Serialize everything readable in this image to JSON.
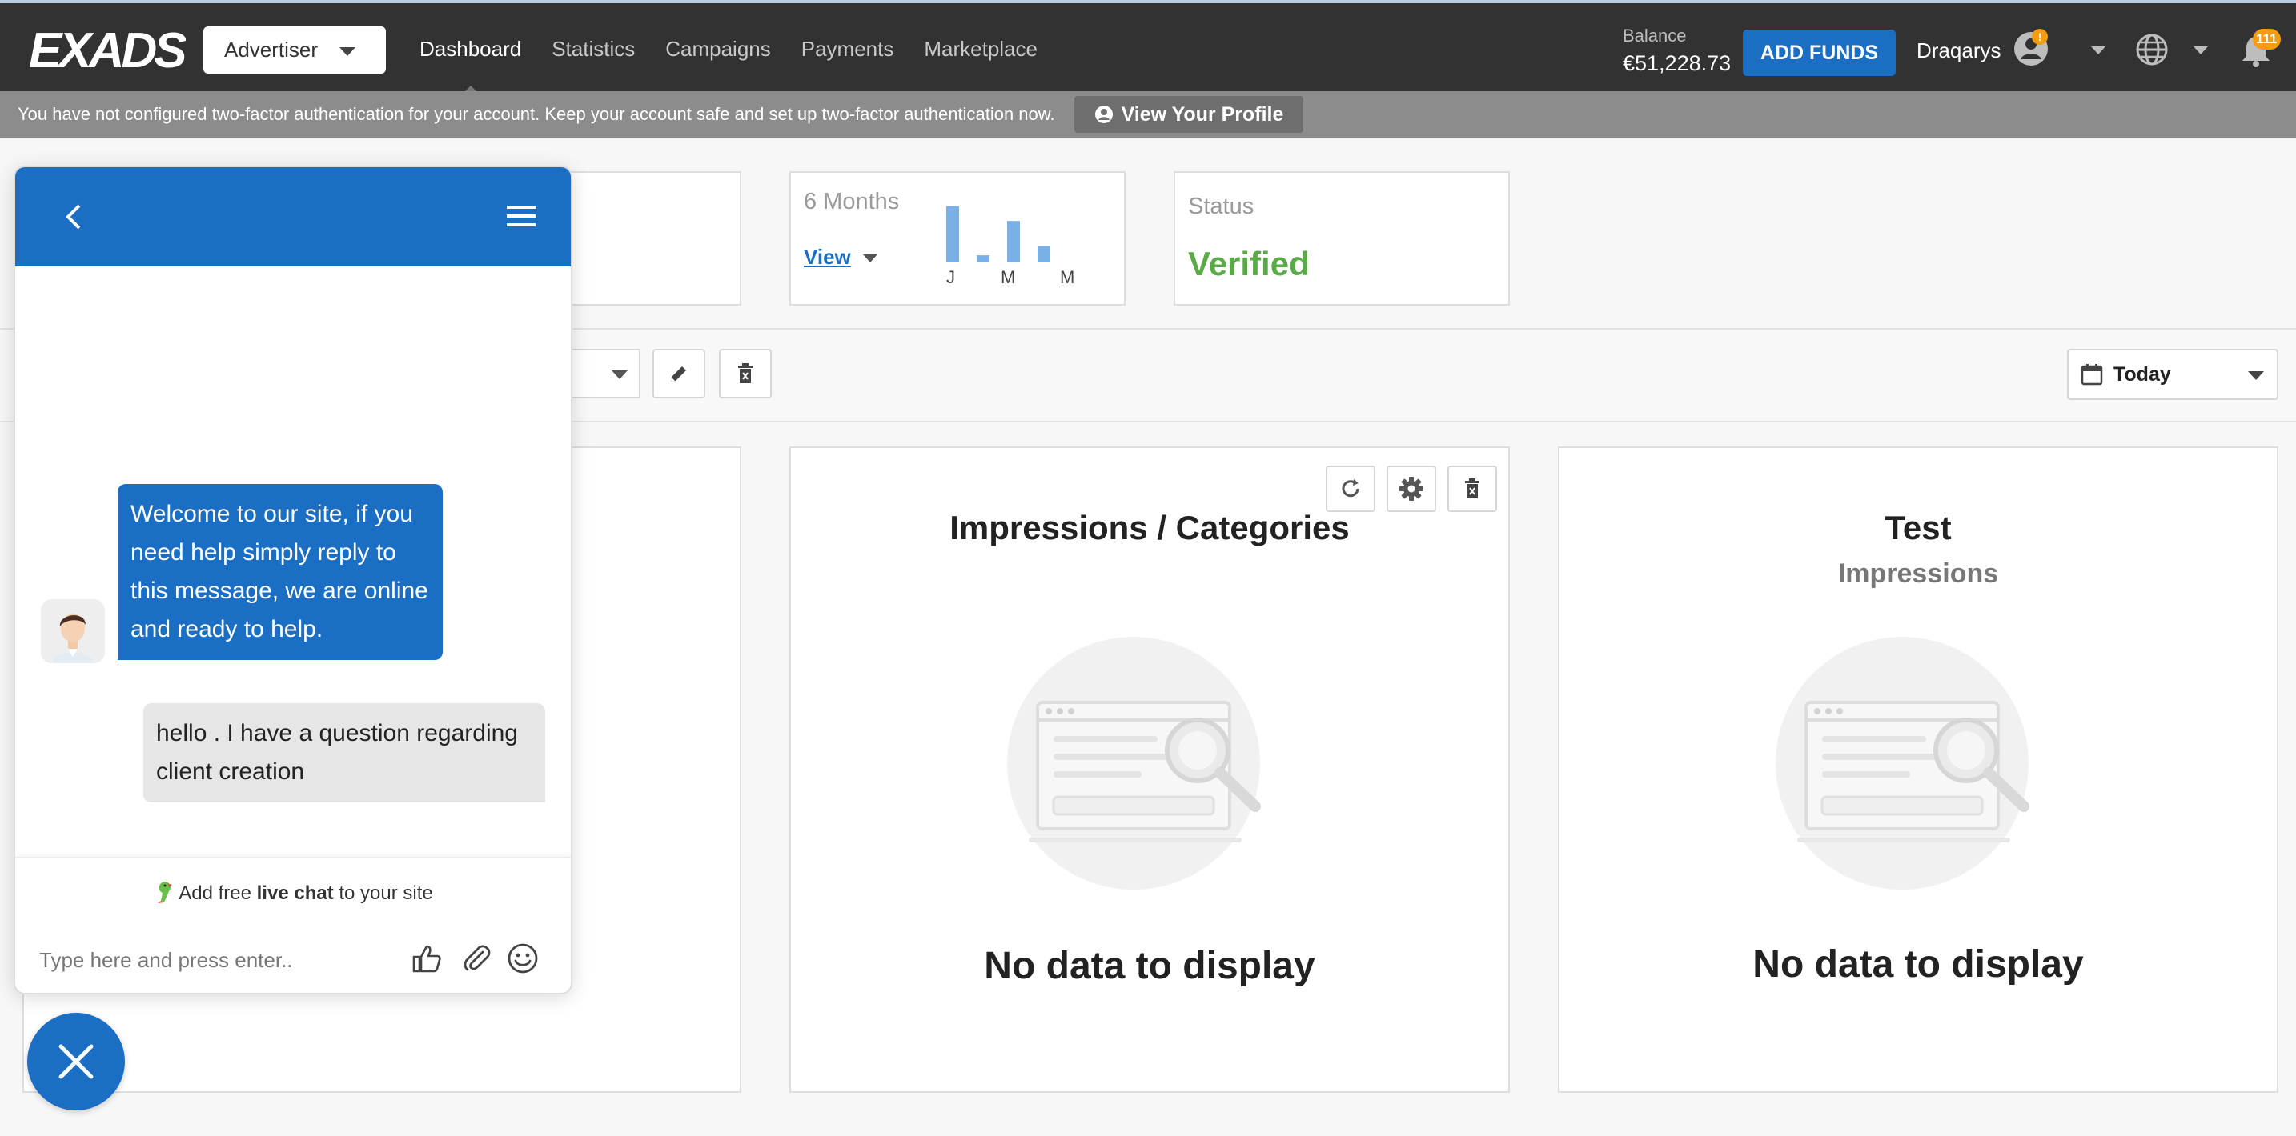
{
  "app": {
    "logo_text": "EXADS"
  },
  "topnav": {
    "role": "Advertiser",
    "links": [
      "Dashboard",
      "Statistics",
      "Campaigns",
      "Payments",
      "Marketplace"
    ],
    "active_link": "Dashboard",
    "balance_label": "Balance",
    "balance_value": "€51,228.73",
    "add_funds_label": "ADD FUNDS",
    "username": "Draqarys",
    "user_badge": "!",
    "notifications_count": "111"
  },
  "banner": {
    "message": "You have not configured two-factor authentication for your account. Keep your account safe and set up two-factor authentication now.",
    "action_label": "View Your Profile"
  },
  "summary": {
    "months_card": {
      "title": "6 Months",
      "view_label": "View",
      "month_labels": [
        "J",
        "M",
        "M"
      ],
      "bars": [
        0.95,
        0.12,
        0.7,
        0.28
      ]
    },
    "status_card": {
      "label": "Status",
      "value": "Verified"
    }
  },
  "toolbar": {
    "date_range": "Today"
  },
  "widgets": [
    {
      "title": "Impressions / Categories",
      "subtitle": "",
      "empty_text": "No data to display"
    },
    {
      "title": "Test",
      "subtitle": "Impressions",
      "empty_text": "No data to display"
    }
  ],
  "chat": {
    "agent_message": "Welcome to our site, if you need help simply reply to this message, we are online and ready to help.",
    "user_message": "hello . I have a question regarding client creation",
    "promo_prefix": "Add free ",
    "promo_bold": "live chat",
    "promo_suffix": " to your site",
    "input_placeholder": "Type here and press enter.."
  },
  "colors": {
    "primary": "#1a6ec4",
    "nav_bg": "#323232",
    "banner_bg": "#8c8c8c",
    "verified": "#5aab48",
    "badge": "#f39c12"
  }
}
